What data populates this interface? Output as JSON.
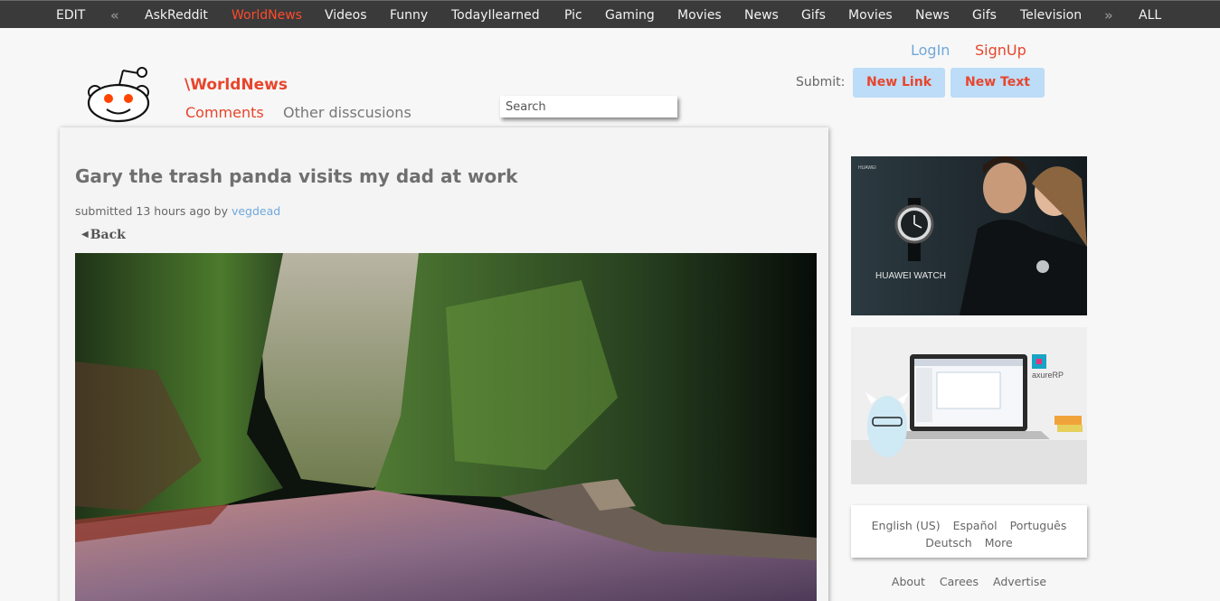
{
  "nav": {
    "items": [
      {
        "label": "EDIT",
        "active": false
      },
      {
        "label": "AskReddit",
        "active": false
      },
      {
        "label": "WorldNews",
        "active": true
      },
      {
        "label": "Videos",
        "active": false
      },
      {
        "label": "Funny",
        "active": false
      },
      {
        "label": "TodayIlearned",
        "active": false
      },
      {
        "label": "Pic",
        "active": false
      },
      {
        "label": "Gaming",
        "active": false
      },
      {
        "label": "Movies",
        "active": false
      },
      {
        "label": "News",
        "active": false
      },
      {
        "label": "Gifs",
        "active": false
      },
      {
        "label": "Movies",
        "active": false
      },
      {
        "label": "News",
        "active": false
      },
      {
        "label": "Gifs",
        "active": false
      },
      {
        "label": "Television",
        "active": false
      },
      {
        "label": "ALL",
        "active": false
      }
    ],
    "prev_arrow": "«",
    "next_arrow": "»",
    "active_color": "#ff4a2b"
  },
  "header": {
    "subreddit": "\\WorldNews",
    "tabs": [
      "Comments",
      "Other disscusions"
    ],
    "search_placeholder": "Search",
    "login": "LogIn",
    "signup": "SignUp",
    "submit_label": "Submit:",
    "new_link": "New Link",
    "new_text": "New Text",
    "accent": "#e8452c",
    "link_color": "#6fa8dc"
  },
  "post": {
    "title": "Gary the trash panda visits my dad at work",
    "submitted_prefix": "submitted 13 hours ago by",
    "author": "vegdead",
    "back": "Back"
  },
  "sidebar": {
    "ad1": {
      "brand": "HUAWEI",
      "product": "HUAWEI WATCH"
    },
    "ad2": {
      "brand": "axureRP"
    },
    "languages": [
      "English (US)",
      "Español",
      "Português",
      "Deutsch",
      "More"
    ],
    "footer_links": [
      "About",
      "Carees",
      "Advertise"
    ]
  }
}
